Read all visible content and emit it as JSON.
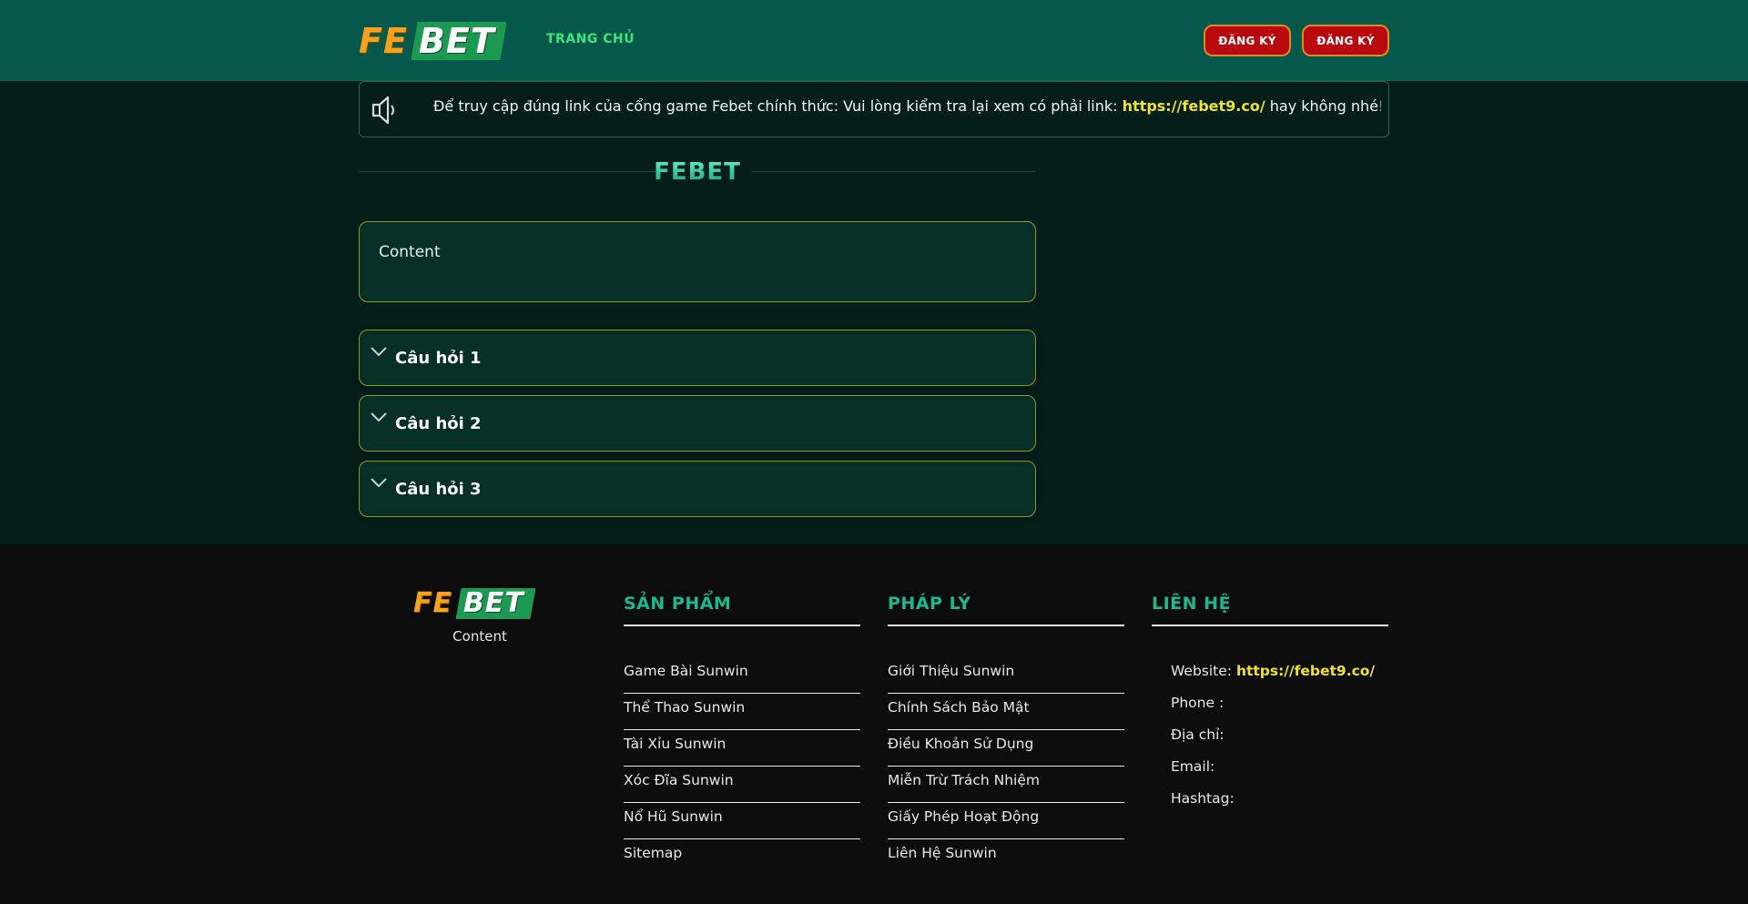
{
  "header": {
    "logo_fe": "FE",
    "logo_bet": "BET",
    "nav_home": "TRANG CHỦ",
    "register_1": "ĐĂNG KÝ",
    "register_2": "ĐĂNG KÝ"
  },
  "notice": {
    "icon": "speaker-icon",
    "text_before": "Để truy cập đúng link của cổng game Febet chính thức: Vui lòng kiểm tra lại xem có phải link: ",
    "link": "https://febet9.co/",
    "text_after": " hay không nhé! Xin cảm ơn."
  },
  "section": {
    "title": "FEBET",
    "content": "Content"
  },
  "faq": [
    {
      "title": "Câu hỏi 1"
    },
    {
      "title": "Câu hỏi 2"
    },
    {
      "title": "Câu hỏi 3"
    }
  ],
  "footer": {
    "logo_fe": "FE",
    "logo_bet": "BET",
    "logo_caption": "Content",
    "products": {
      "heading": "SẢN PHẨM",
      "items": [
        "Game Bài Sunwin",
        "Thể Thao Sunwin",
        "Tài Xỉu Sunwin",
        "Xóc Đĩa Sunwin",
        "Nổ Hũ Sunwin",
        "Sitemap"
      ]
    },
    "legal": {
      "heading": "PHÁP LÝ",
      "items": [
        "Giới Thiệu Sunwin",
        "Chính Sách Bảo Mật",
        "Điều Khoản Sử Dụng",
        "Miễn Trừ Trách Nhiệm",
        "Giấy Phép Hoạt Động",
        "Liên Hệ Sunwin"
      ]
    },
    "contact": {
      "heading": "LIÊN HỆ",
      "website_label": "Website: ",
      "website_link": "https://febet9.co/",
      "phone_label": "Phone :",
      "address_label": "Địa chỉ:",
      "email_label": "Email:",
      "hashtag_label": "Hashtag:"
    }
  },
  "colors": {
    "header_bg": "#06584a",
    "page_bg": "#051e1a",
    "footer_bg": "#0c0c0c",
    "accent_teal": "#1cb990",
    "link_yellow": "#f0e232",
    "button_red": "#b9090f",
    "button_border": "#e08a1a"
  }
}
